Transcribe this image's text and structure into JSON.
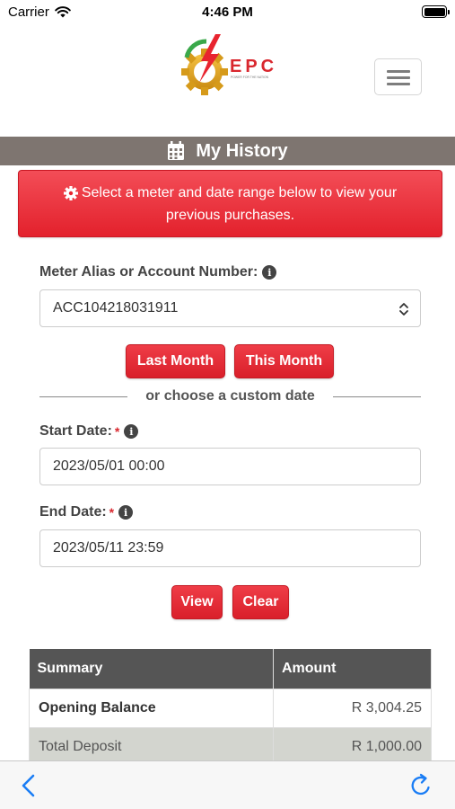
{
  "status_bar": {
    "carrier": "Carrier",
    "time": "4:46 PM",
    "battery": "full"
  },
  "header": {
    "logo_text": "EPC",
    "logo_tagline": "POWER FOR THE NATION",
    "menu_icon": "hamburger-icon"
  },
  "page": {
    "title": "My History",
    "title_icon": "calendar-icon"
  },
  "alert": {
    "icon": "gear-icon",
    "line1": "Select a meter and date range below to view your",
    "line2": "previous purchases.",
    "color": "#e8242f"
  },
  "form": {
    "meter_label": "Meter Alias or Account Number:",
    "meter_value": "ACC104218031911",
    "last_month_label": "Last Month",
    "this_month_label": "This Month",
    "divider_text": "or choose a custom date",
    "start_label": "Start Date:",
    "start_value": "2023/05/01 00:00",
    "end_label": "End Date:",
    "end_value": "2023/05/11 23:59",
    "required_marker": "*",
    "view_label": "View",
    "clear_label": "Clear"
  },
  "summary": {
    "headers": [
      "Summary",
      "Amount"
    ],
    "rows": [
      {
        "label": "Opening Balance",
        "amount": "R 3,004.25"
      },
      {
        "label": "Total Deposit",
        "amount": "R 1,000.00"
      }
    ]
  },
  "toolbar": {
    "back_icon": "chevron-left-icon",
    "reload_icon": "reload-icon"
  },
  "colors": {
    "accent": "#e8242f",
    "title_bar": "#7e7570",
    "link": "#1a7df5"
  }
}
